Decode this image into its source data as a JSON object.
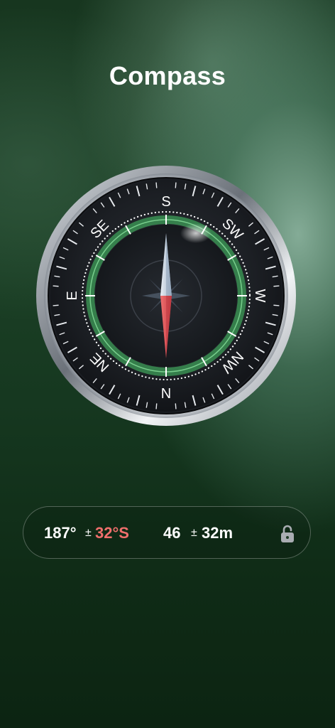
{
  "header": {
    "title": "Compass"
  },
  "compass": {
    "labels": {
      "s": "S",
      "sw": "SW",
      "w": "W",
      "nw": "NW",
      "n": "N",
      "ne": "NE",
      "e": "E",
      "se": "SE"
    },
    "needle_colors": {
      "north": "#e85a5e",
      "south": "#cfd8e4"
    },
    "ring_color": "#4fb26a"
  },
  "readout": {
    "heading": "187°",
    "heading_pm": "±",
    "heading_accuracy": "32°S",
    "altitude": "46",
    "altitude_pm": "±",
    "altitude_accuracy": "32m",
    "lock_icon": "unlock-icon"
  }
}
